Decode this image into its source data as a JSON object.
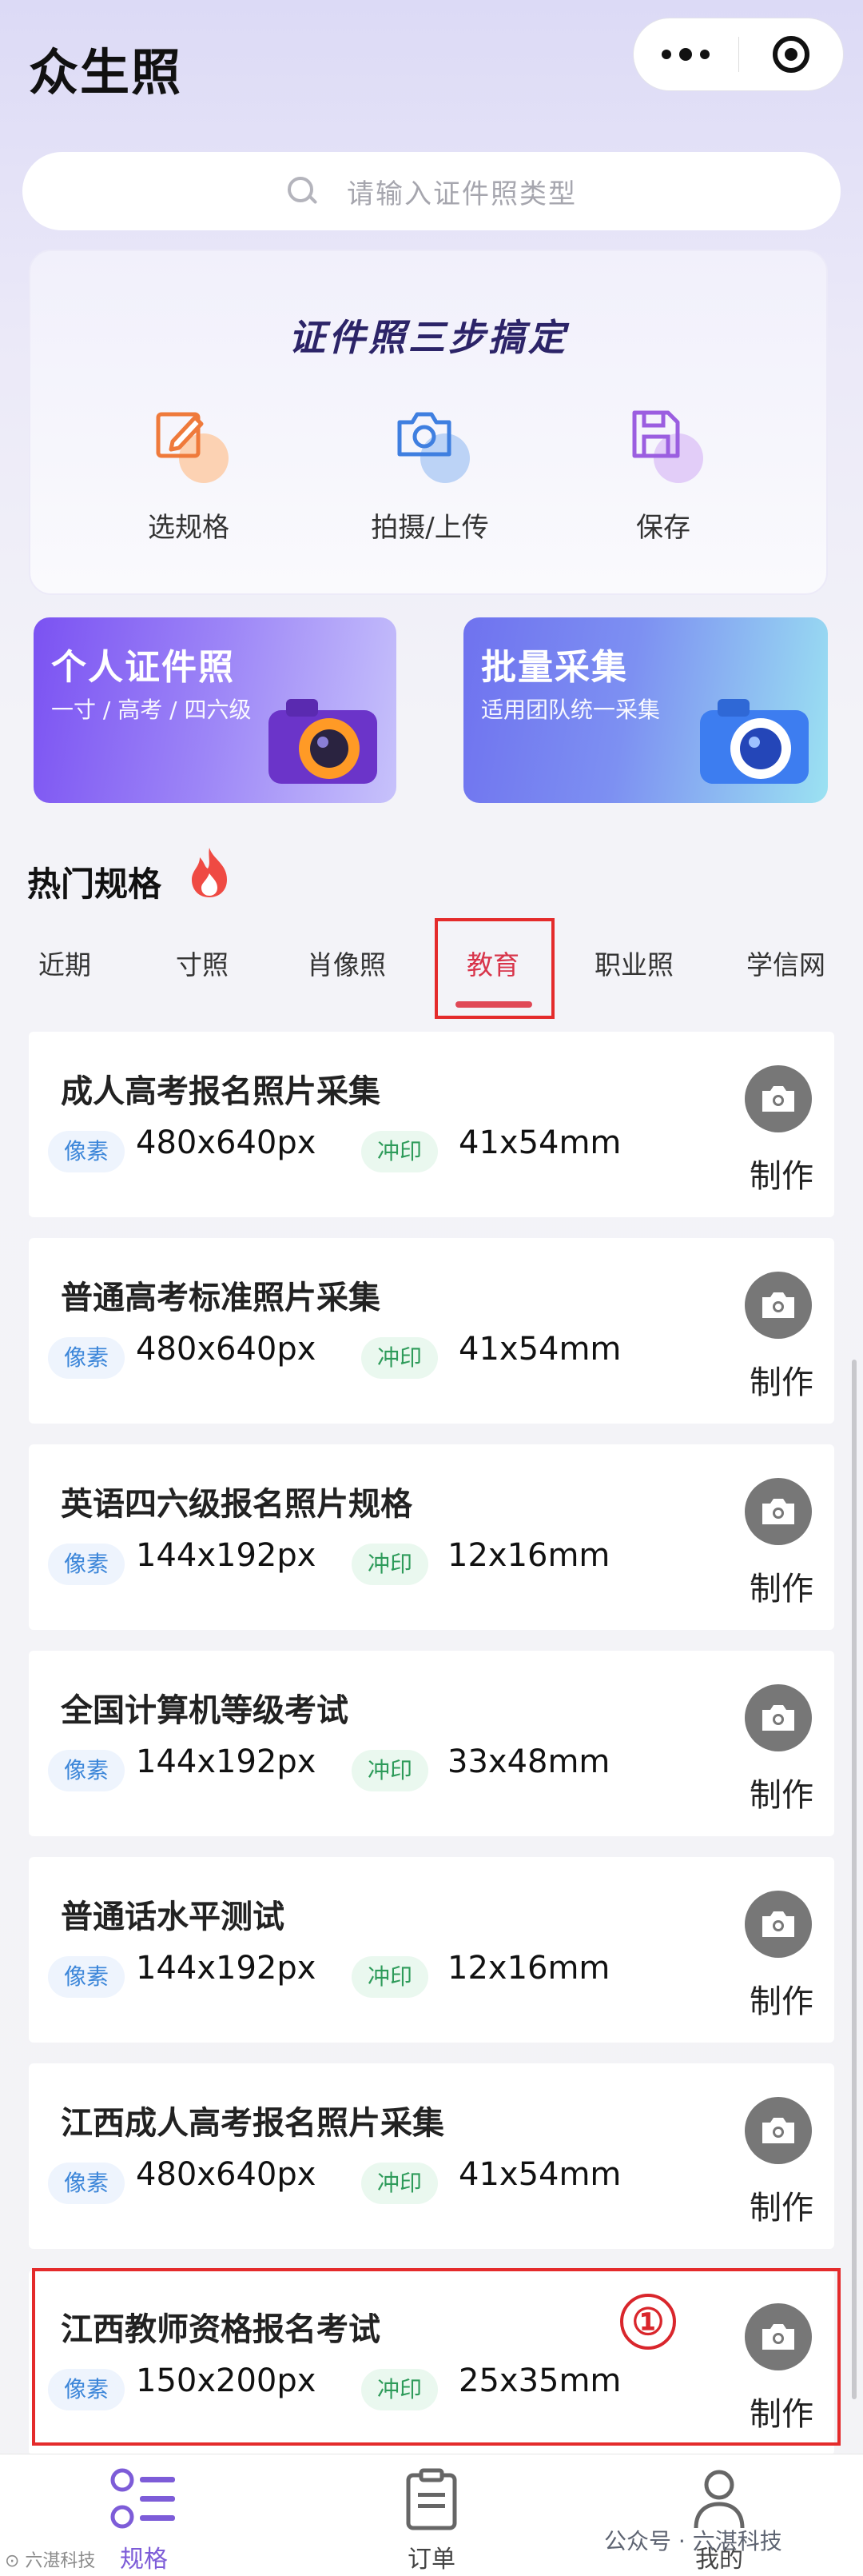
{
  "app": {
    "title": "众生照"
  },
  "search": {
    "placeholder": "请输入证件照类型"
  },
  "steps": {
    "title": "证件照三步搞定",
    "items": [
      {
        "label": "选规格",
        "icon": "edit-icon",
        "color": "#f08a4b"
      },
      {
        "label": "拍摄/上传",
        "icon": "camera-icon",
        "color": "#4b86e8"
      },
      {
        "label": "保存",
        "icon": "save-icon",
        "color": "#a46ce3"
      }
    ]
  },
  "promos": [
    {
      "title": "个人证件照",
      "subtitle": "一寸 / 高考 / 四六级"
    },
    {
      "title": "批量采集",
      "subtitle": "适用团队统一采集"
    }
  ],
  "hot": {
    "title": "热门规格"
  },
  "tabs": [
    {
      "label": "近期"
    },
    {
      "label": "寸照"
    },
    {
      "label": "肖像照"
    },
    {
      "label": "教育",
      "active": true
    },
    {
      "label": "职业照"
    },
    {
      "label": "学信网"
    }
  ],
  "tags": {
    "pixel": "像素",
    "print": "冲印",
    "make": "制作"
  },
  "items": [
    {
      "name": "成人高考报名照片采集",
      "pixel": "480x640px",
      "print": "41x54mm"
    },
    {
      "name": "普通高考标准照片采集",
      "pixel": "480x640px",
      "print": "41x54mm"
    },
    {
      "name": "英语四六级报名照片规格",
      "pixel": "144x192px",
      "print": "12x16mm"
    },
    {
      "name": "全国计算机等级考试",
      "pixel": "144x192px",
      "print": "33x48mm"
    },
    {
      "name": "普通话水平测试",
      "pixel": "144x192px",
      "print": "12x16mm"
    },
    {
      "name": "江西成人高考报名照片采集",
      "pixel": "480x640px",
      "print": "41x54mm"
    },
    {
      "name": "江西教师资格报名考试",
      "pixel": "150x200px",
      "print": "25x35mm"
    }
  ],
  "annotation": {
    "marker": "①"
  },
  "bottom_nav": [
    {
      "label": "规格",
      "active": true,
      "icon": "list-icon"
    },
    {
      "label": "订单",
      "icon": "clipboard-icon"
    },
    {
      "label": "我的",
      "icon": "user-icon"
    }
  ],
  "watermark": {
    "text": "公众号 · 六湛科技",
    "left": "⊙ 六湛科技"
  },
  "colors": {
    "accent": "#7d5cd8",
    "active_tab": "#d8344a",
    "highlight": "#e42b2b"
  }
}
